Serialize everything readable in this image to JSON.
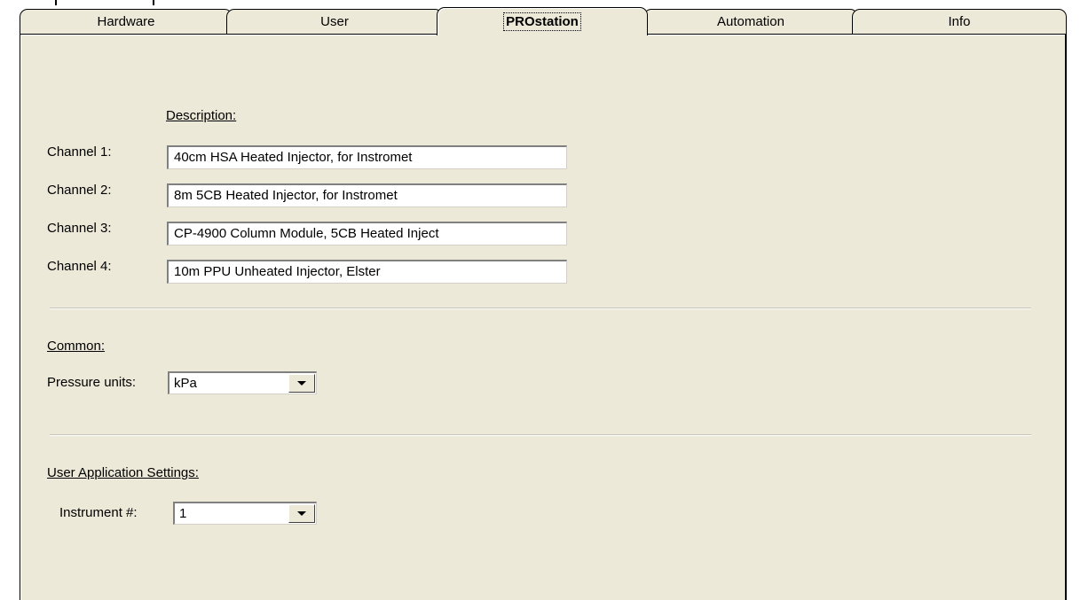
{
  "tabs": [
    {
      "label": "Hardware"
    },
    {
      "label": "User"
    },
    {
      "label": "PROstation"
    },
    {
      "label": "Automation"
    },
    {
      "label": "Info"
    }
  ],
  "active_tab": "PROstation",
  "description": {
    "header": "Description:",
    "channels": [
      {
        "label": "Channel 1:",
        "value": "40cm HSA Heated Injector, for Instromet"
      },
      {
        "label": "Channel 2:",
        "value": "8m 5CB Heated Injector, for Instromet"
      },
      {
        "label": "Channel 3:",
        "value": "CP-4900 Column Module, 5CB Heated Inject"
      },
      {
        "label": "Channel 4:",
        "value": "10m PPU Unheated Injector, Elster"
      }
    ]
  },
  "common": {
    "header": "Common:",
    "pressure_label": "Pressure units:",
    "pressure_value": "kPa"
  },
  "user_app": {
    "header": "User Application Settings:",
    "instrument_label": "Instrument #:",
    "instrument_value": "1"
  },
  "icons": {
    "dropdown": "chevron-down-icon"
  }
}
